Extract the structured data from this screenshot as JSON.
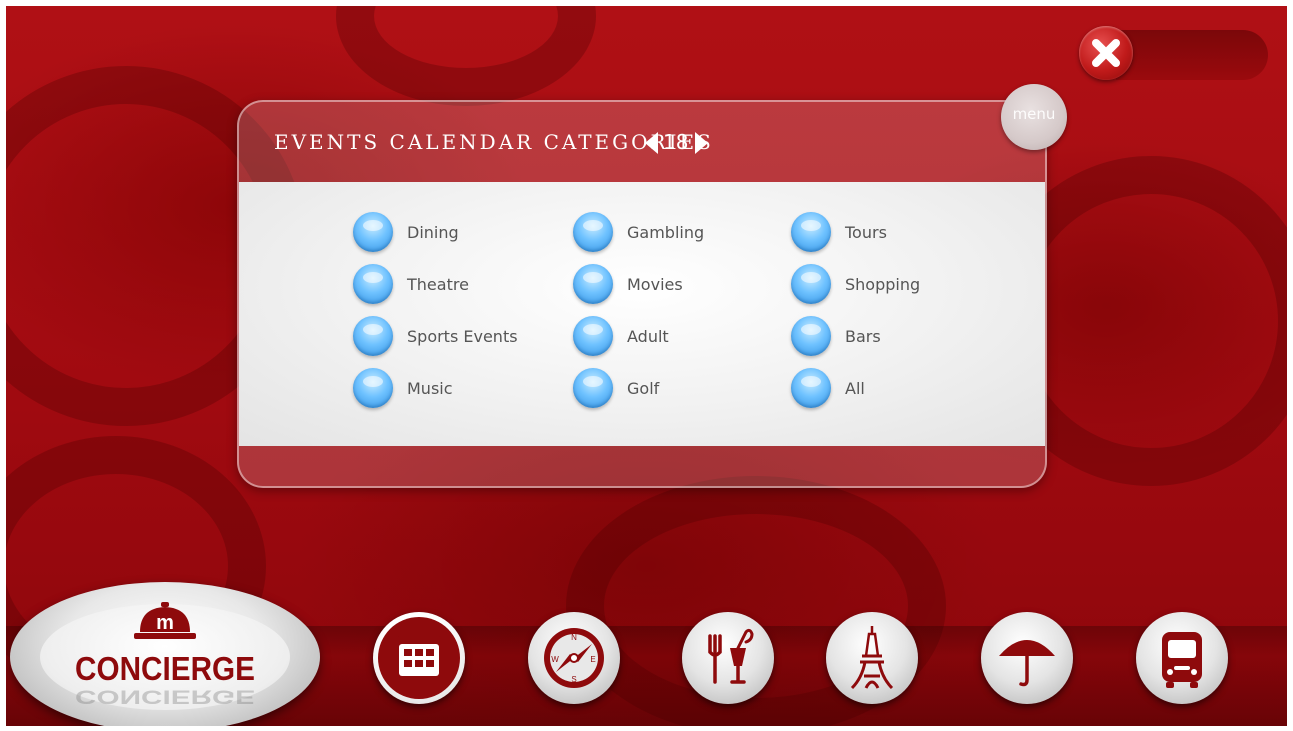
{
  "panel": {
    "title": "EVENTS CALENDAR CATEGORIES",
    "page_number": "18"
  },
  "menu_button": {
    "label": "menu"
  },
  "categories": [
    [
      "Dining",
      "Gambling",
      "Tours"
    ],
    [
      "Theatre",
      "Movies",
      "Shopping"
    ],
    [
      "Sports Events",
      "Adult",
      "Bars"
    ],
    [
      "Music",
      "Golf",
      "All"
    ]
  ],
  "logo": {
    "text": "CONCIERGE",
    "letter": "m"
  },
  "dock": [
    {
      "name": "calendar-icon",
      "active": true
    },
    {
      "name": "compass-icon",
      "active": false
    },
    {
      "name": "dining-icon",
      "active": false
    },
    {
      "name": "eiffel-tower-icon",
      "active": false
    },
    {
      "name": "umbrella-icon",
      "active": false
    },
    {
      "name": "bus-icon",
      "active": false
    }
  ],
  "colors": {
    "accent": "#8e0a0c",
    "background": "#a00a10",
    "radio": "#6fc2ff"
  }
}
